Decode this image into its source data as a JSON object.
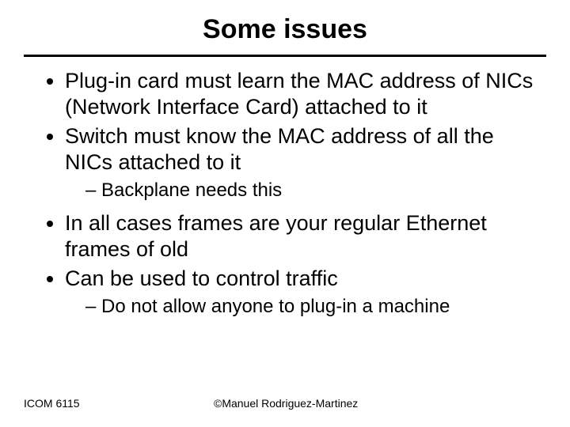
{
  "title": "Some issues",
  "bullets": {
    "b1": "Plug-in card must learn the MAC address of NICs (Network Interface Card) attached to it",
    "b2": "Switch must know the MAC address of all the NICs attached to it",
    "b2_sub1": "Backplane needs this",
    "b3": "In all cases frames are your regular Ethernet frames of old",
    "b4": "Can be used to control traffic",
    "b4_sub1": "Do not allow anyone to plug-in a machine"
  },
  "footer": {
    "left": "ICOM 6115",
    "center": "©Manuel Rodriguez-Martinez"
  }
}
